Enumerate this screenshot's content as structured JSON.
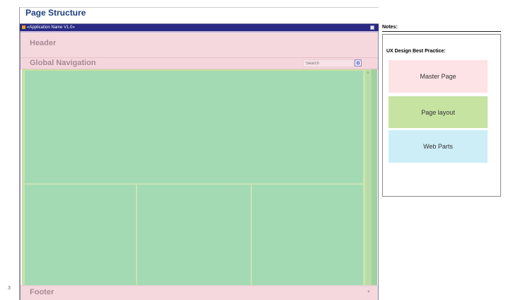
{
  "page": {
    "title": "Page Structure",
    "number": "3"
  },
  "window": {
    "app_name": "«Application Name V1.0»"
  },
  "layout": {
    "header_label": "Header",
    "nav_label": "Global Navigation",
    "search_placeholder": "Search",
    "footer_label": "Footer"
  },
  "notes": {
    "label": "Notes:",
    "best_practice_title": "UX Design Best Practice:",
    "cards": [
      {
        "label": "Master Page",
        "color": "#fde3e6"
      },
      {
        "label": "Page layout",
        "color": "#c6e3a2"
      },
      {
        "label": "Web Parts",
        "color": "#cdeef7"
      }
    ]
  },
  "colors": {
    "title": "#1f3f80",
    "titlebar": "#2a2a82",
    "header_bg": "#f5d8dd",
    "content_bg": "#a3dab3"
  }
}
